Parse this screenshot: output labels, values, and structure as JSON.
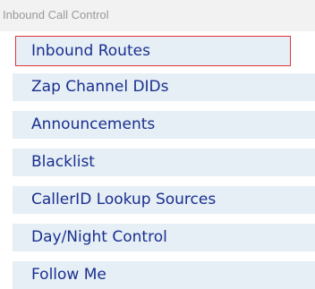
{
  "section": {
    "title": "Inbound Call Control"
  },
  "nav": {
    "items": [
      {
        "label": "Inbound Routes",
        "selected": true
      },
      {
        "label": "Zap Channel DIDs",
        "selected": false
      },
      {
        "label": "Announcements",
        "selected": false
      },
      {
        "label": "Blacklist",
        "selected": false
      },
      {
        "label": "CallerID Lookup Sources",
        "selected": false
      },
      {
        "label": "Day/Night Control",
        "selected": false
      },
      {
        "label": "Follow Me",
        "selected": false
      }
    ]
  },
  "colors": {
    "header_background": "#f2f2f2",
    "header_text": "#999999",
    "item_background": "#e6eff5",
    "item_text": "#1a2f8f",
    "selected_border": "#e0353b"
  }
}
